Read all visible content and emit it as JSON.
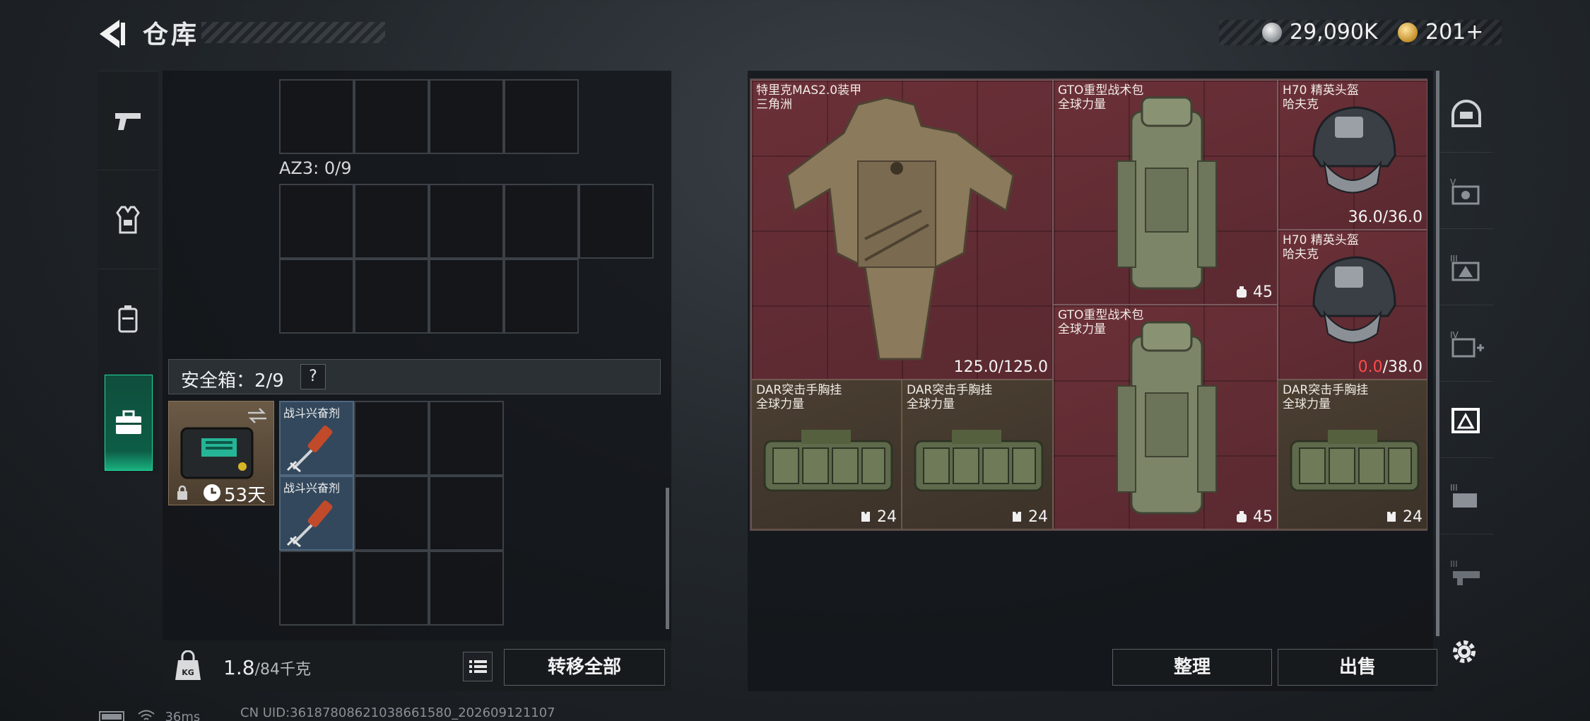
{
  "header": {
    "title": "仓库",
    "currency_silver": "29,090K",
    "currency_gold": "201+"
  },
  "storage": {
    "az3_label": "AZ3: 0/9",
    "safebox_label": "安全箱：2/9",
    "help": "?",
    "safe_case_time": "53天",
    "stim_1": "战斗兴奋剂",
    "stim_2": "战斗兴奋剂",
    "weight_value": "1.8",
    "weight_max": "/84千克",
    "transfer_all": "转移全部"
  },
  "loot": {
    "armor": {
      "name": "特里克MAS2.0装甲\n三角洲",
      "durability": "125.0/125.0"
    },
    "backpack_1": {
      "name": "GTO重型战术包\n全球力量",
      "capacity": "45"
    },
    "helmet_1": {
      "name": "H70 精英头盔\n哈夫克",
      "durability": "36.0/36.0"
    },
    "helmet_2": {
      "name": "H70 精英头盔\n哈夫克",
      "durability_current": "0.0",
      "durability_max": "/38.0"
    },
    "backpack_2": {
      "name": "GTO重型战术包\n全球力量",
      "capacity": "45"
    },
    "rig_1": {
      "name": "DAR突击手胸挂\n全球力量",
      "capacity": "24"
    },
    "rig_2": {
      "name": "DAR突击手胸挂\n全球力量",
      "capacity": "24"
    },
    "rig_3": {
      "name": "DAR突击手胸挂\n全球力量",
      "capacity": "24"
    }
  },
  "actions": {
    "sort": "整理",
    "sell": "出售"
  },
  "status": {
    "ping": "36ms",
    "uid": "CN UID:36187808621038661580_202609121107"
  },
  "colors": {
    "accent_green": "#1fe0a0",
    "loot_red": "#6b3038",
    "durability_zero": "#ff4b4b"
  }
}
